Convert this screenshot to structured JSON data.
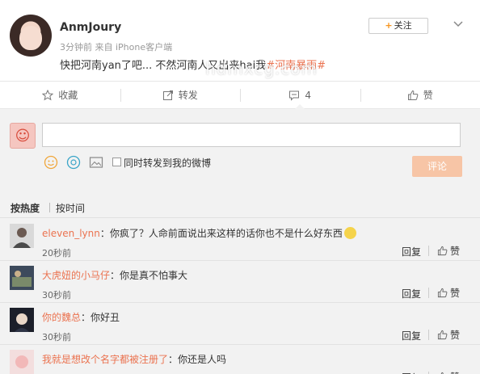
{
  "post": {
    "username": "AnmJoury",
    "meta": "3分钟前 来自 iPhone客户端",
    "content_text": "快把河南yan了吧... 不然河南人又出来hai我",
    "topic": "#河南暴雨#",
    "follow_label": "关注",
    "watermark": "hdmxcg.com"
  },
  "actions": [
    {
      "label": "收藏",
      "icon": "star-icon"
    },
    {
      "label": "转发",
      "icon": "repost-icon"
    },
    {
      "label": "4",
      "icon": "comment-icon"
    },
    {
      "label": "赞",
      "icon": "thumbs-up-icon"
    }
  ],
  "composer": {
    "input_value": "",
    "repost_label": "同时转发到我的微博",
    "submit_label": "评论"
  },
  "sort": {
    "hot": "按热度",
    "time": "按时间"
  },
  "comments": [
    {
      "user": "eleven_lynn",
      "text": "你疯了？人命前面说出来这样的话你也不是什么好东西",
      "time": "20秒前",
      "reply": "回复",
      "like": "赞"
    },
    {
      "user": "大虎妞的小马仔",
      "text": "你是真不怕事大",
      "time": "30秒前",
      "reply": "回复",
      "like": "赞"
    },
    {
      "user": "你的魏总",
      "text": "你好丑",
      "time": "30秒前",
      "reply": "回复",
      "like": "赞"
    },
    {
      "user": "我就是想改个名字都被注册了",
      "text": "你还是人吗",
      "time": "",
      "reply": "回复",
      "like": "赞"
    }
  ],
  "colors": {
    "accent": "#eb7350",
    "follow_plus": "#f7941d",
    "submit_disabled": "#f7c5a6"
  }
}
